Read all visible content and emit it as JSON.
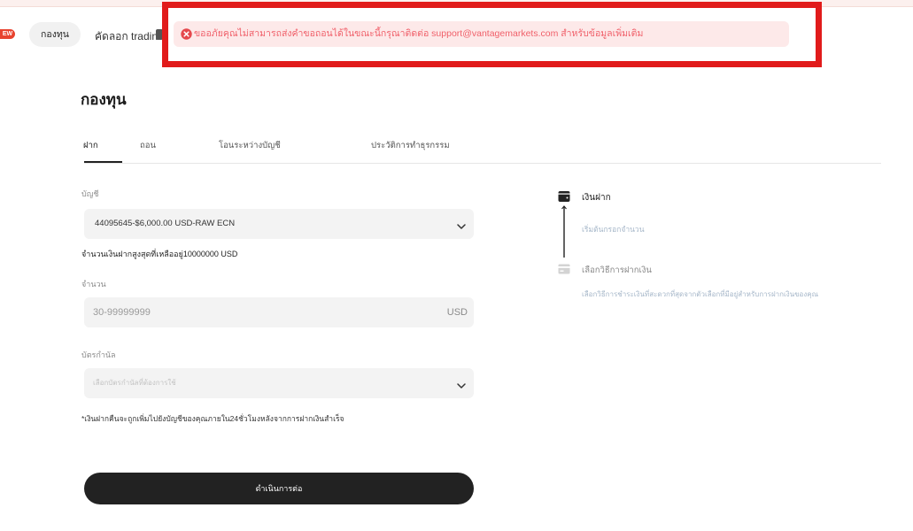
{
  "topnav": {
    "new_badge": "EW",
    "funds_tab": "กองทุน",
    "copy_trading_tab": "คัดลอก tradin"
  },
  "alert": {
    "icon": "error-circle-icon",
    "message": "ขออภัยคุณไม่สามารถส่งคำขอถอนได้ในขณะนี้กรุณาติดต่อ support@vantagemarkets.com สำหรับข้อมูลเพิ่มเติม"
  },
  "page": {
    "title": "กองทุน"
  },
  "tabs": [
    {
      "label": "ฝาก",
      "active": true
    },
    {
      "label": "ถอน",
      "active": false
    },
    {
      "label": "โอนระหว่างบัญชี",
      "active": false
    },
    {
      "label": "ประวัติการทำธุรกรรม",
      "active": false
    }
  ],
  "form": {
    "account": {
      "label": "บัญชี",
      "value": "44095645-$6,000.00 USD-RAW ECN",
      "icon": "chevron-down-icon"
    },
    "max_deposit_note": "จำนวนเงินฝากสูงสุดที่เหลืออยู่10000000 USD",
    "amount": {
      "label": "จำนวน",
      "placeholder": "30-99999999",
      "currency": "USD"
    },
    "voucher": {
      "label": "บัตรกำนัล",
      "placeholder": "เลือกบัตรกำนัลที่ต้องการใช้",
      "icon": "chevron-down-icon"
    },
    "footnote": "*เงินฝากคืนจะถูกเพิ่มไปยังบัญชีของคุณภายใน24ชั่วโมงหลังจากการฝากเงินสำเร็จ",
    "submit_label": "ดำเนินการต่อ"
  },
  "steps": [
    {
      "title": "เงินฝาก",
      "subtitle": "เริ่มต้นกรอกจำนวน",
      "icon": "wallet-icon",
      "active": true
    },
    {
      "title": "เลือกวิธีการฝากเงิน",
      "subtitle": "เลือกวิธีการชำระเงินที่สะดวกที่สุดจากตัวเลือกที่มีอยู่สำหรับการฝากเงินของคุณ",
      "icon": "card-icon",
      "active": false
    }
  ],
  "colors": {
    "brand_red": "#e8432f",
    "annotation_red": "#e11b1b",
    "alert_bg": "#fde9e9",
    "alert_text": "#f0606a",
    "field_bg": "#f3f3f3",
    "primary_button": "#222222"
  }
}
